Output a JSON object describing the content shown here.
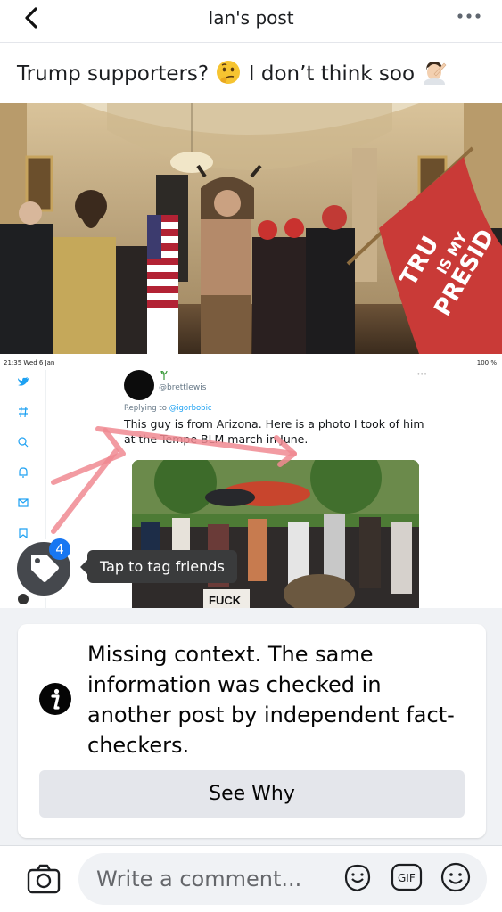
{
  "header": {
    "title": "Ian's post",
    "back_icon": "chevron-left-icon",
    "more_icon": "more-dots-icon"
  },
  "post": {
    "text_part1": "Trump supporters?",
    "text_part2": "I don’t think soo",
    "emoji1": "thinking-face-emoji",
    "emoji2": "man-facepalming-emoji"
  },
  "photo": {
    "flag_text_line1": "TRU",
    "flag_text_line2": "IS MY",
    "flag_text_line3": "PRESID"
  },
  "screenshot": {
    "status_time": "21:35  Wed 6 Jan",
    "status_battery": "100 %",
    "handle": "@brettlewis",
    "replying_to_prefix": "Replying to ",
    "replying_to_handle": "@igorbobic",
    "tweet_text": "This guy is from Arizona. Here is a photo I took of him at the Tempe BLM march in June.",
    "image_sign_text": "FUCK",
    "more_dots": "•••"
  },
  "tag": {
    "badge_count": "4",
    "tooltip": "Tap to tag friends"
  },
  "fact_check": {
    "text": "Missing context. The same information was checked in another post by independent fact-checkers.",
    "button_label": "See Why"
  },
  "comment": {
    "placeholder": "Write a comment..."
  },
  "colors": {
    "accent": "#1877f2",
    "twitter_blue": "#1da1f2",
    "card_bg": "#f0f2f5"
  }
}
